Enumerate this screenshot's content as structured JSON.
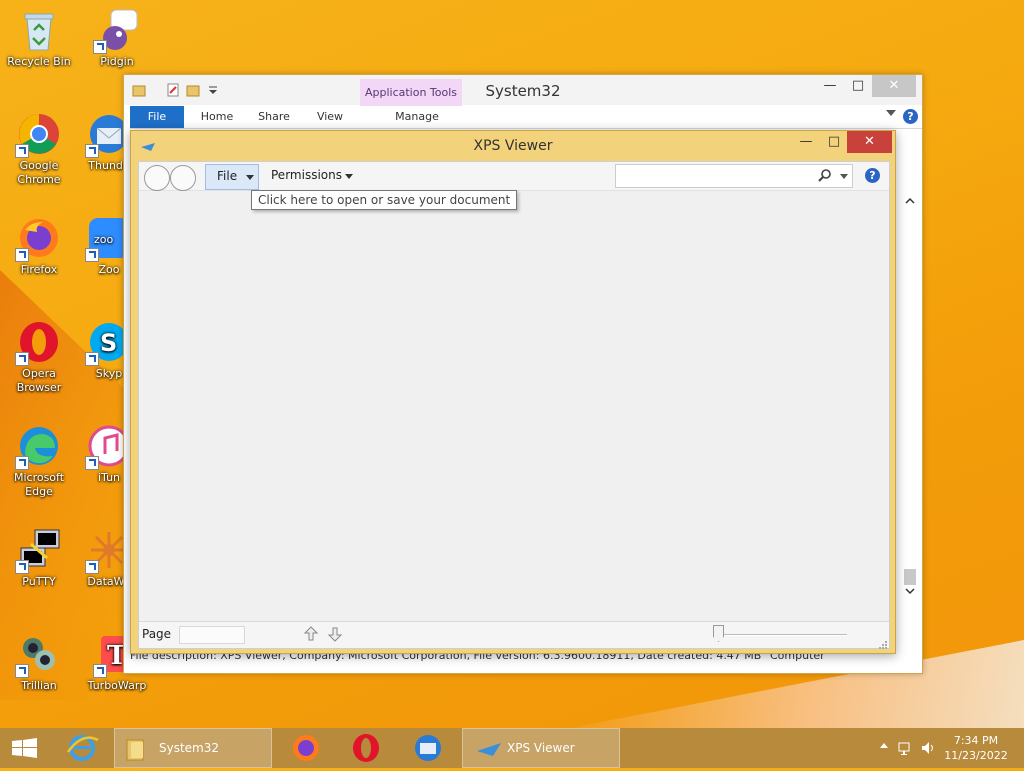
{
  "desktop": {
    "icons": [
      {
        "name": "recycle-bin",
        "label": "Recycle Bin"
      },
      {
        "name": "pidgin",
        "label": "Pidgin"
      },
      {
        "name": "google-chrome",
        "label": "Google Chrome"
      },
      {
        "name": "thunderbird",
        "label": "Thunde"
      },
      {
        "name": "firefox",
        "label": "Firefox"
      },
      {
        "name": "zoom",
        "label": "Zoo"
      },
      {
        "name": "opera-browser",
        "label": "Opera Browser"
      },
      {
        "name": "skype",
        "label": "Skyp"
      },
      {
        "name": "microsoft-edge",
        "label": "Microsoft Edge"
      },
      {
        "name": "itunes",
        "label": "iTun"
      },
      {
        "name": "putty",
        "label": "PuTTY"
      },
      {
        "name": "datawarrior",
        "label": "DataWa"
      },
      {
        "name": "trillian",
        "label": "Trillian"
      },
      {
        "name": "turbowarp",
        "label": "TurboWarp"
      }
    ]
  },
  "explorer": {
    "title": "System32",
    "contextual_tab_group": "Application Tools",
    "tabs": {
      "file": "File",
      "home": "Home",
      "share": "Share",
      "view": "View",
      "manage": "Manage"
    },
    "status": "File description: XPS Viewer, Company: Microsoft Corporation, File version: 6.3.9600.18911, Date created: 4.47 MB",
    "status_right": "Computer"
  },
  "xps": {
    "title": "XPS Viewer",
    "file_menu": "File",
    "permissions_menu": "Permissions",
    "tooltip": "Click here to open or save your document",
    "search_placeholder": "",
    "page_label": "Page",
    "page_value": "",
    "help_glyph": "?"
  },
  "taskbar": {
    "items": [
      {
        "name": "explorer",
        "label": "System32"
      },
      {
        "name": "xps-viewer",
        "label": "XPS Viewer"
      }
    ],
    "time": "7:34 PM",
    "date": "11/23/2022"
  },
  "colors": {
    "accent": "#1e6fc7",
    "close": "#c9413b",
    "xps_frame": "#f3d27c",
    "desktop": "#f5a90f"
  }
}
